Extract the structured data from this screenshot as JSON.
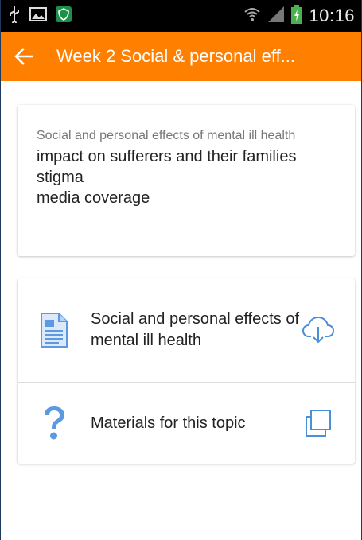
{
  "status_bar": {
    "time": "10:16",
    "icons": [
      "usb-icon",
      "image-icon",
      "shield-icon",
      "wifi-icon",
      "signal-icon",
      "battery-charging-icon"
    ]
  },
  "app_bar": {
    "back_icon": "arrow-left-icon",
    "title": "Week 2 Social & personal eff...",
    "color": "#ff8000"
  },
  "summary": {
    "heading": "Social and personal effects of mental ill health",
    "lines": [
      "impact on sufferers and their families",
      "stigma",
      "media coverage"
    ]
  },
  "items": [
    {
      "label": "Social and personal effects of mental ill health",
      "icon": "document-icon",
      "action_icon": "cloud-download-icon"
    },
    {
      "label": "Materials for this topic",
      "icon": "question-icon",
      "action_icon": "copy-icon"
    }
  ],
  "colors": {
    "accent_blue": "#4a8fd9",
    "text": "#222222",
    "subtle_text": "#777777"
  }
}
